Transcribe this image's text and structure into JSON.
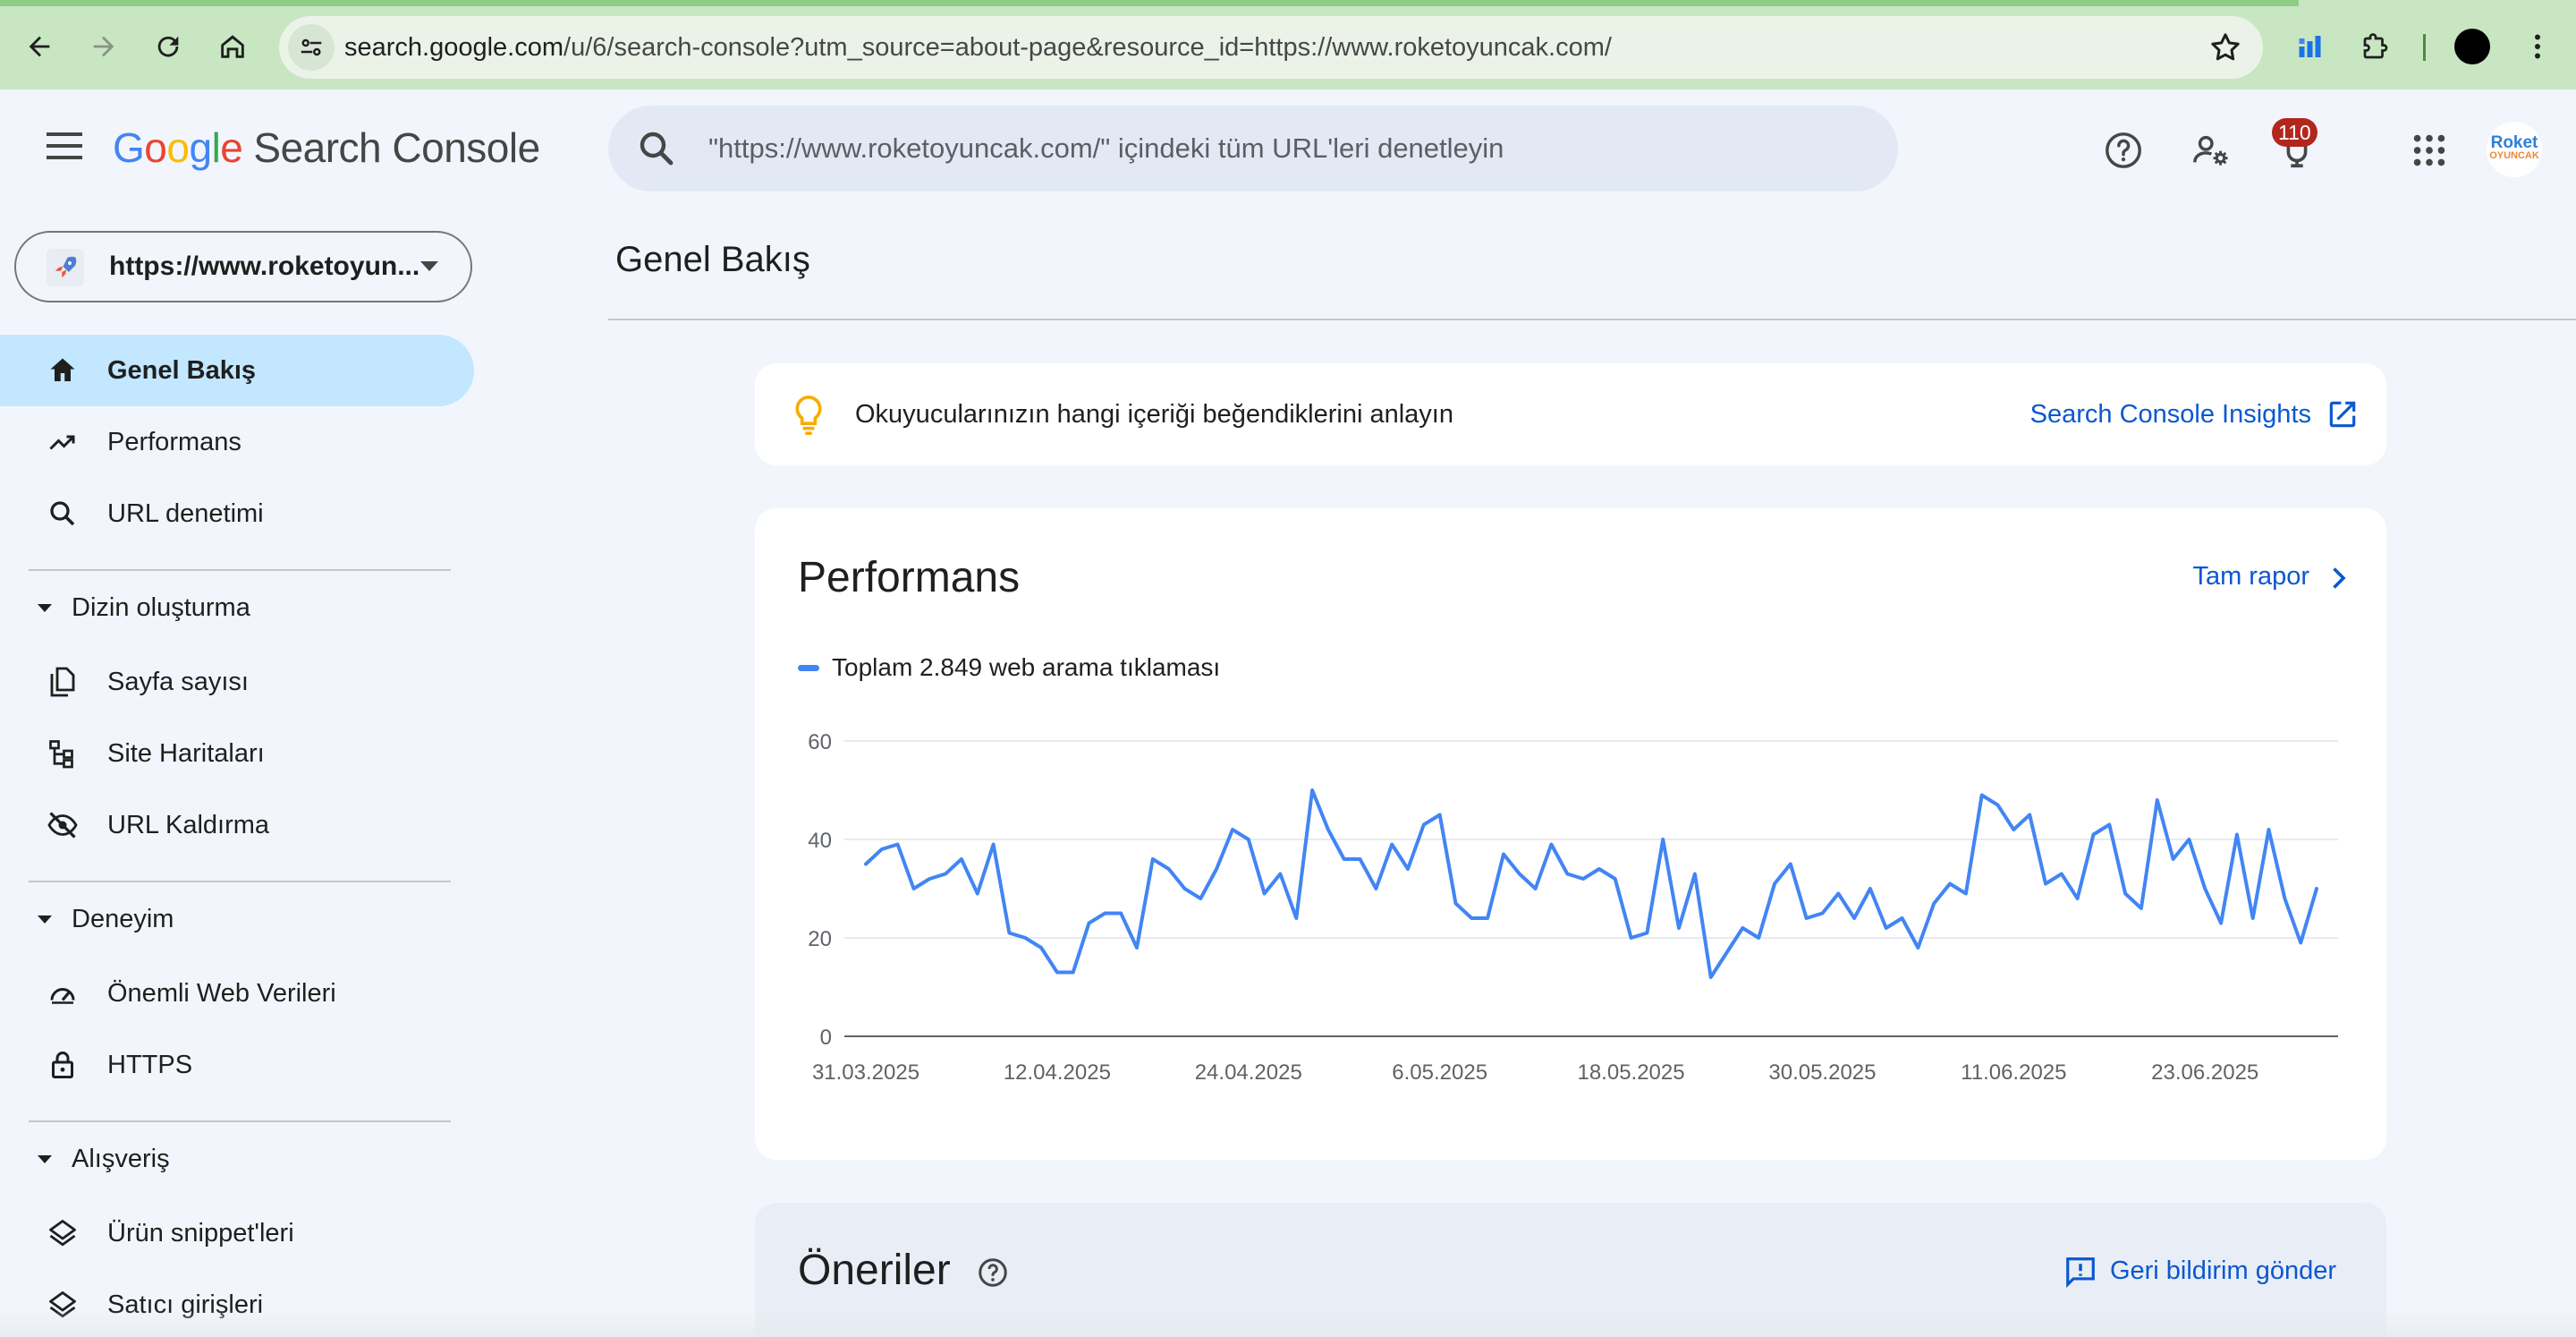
{
  "browser": {
    "url_host": "search.google.com",
    "url_path": "/u/6/search-console?utm_source=about-page&resource_id=https://www.roketoyuncak.com/",
    "icons": [
      "back-icon",
      "forward-icon",
      "reload-icon",
      "home-icon",
      "site-info-icon",
      "bookmark-star-icon",
      "extension-chart-icon",
      "extensions-puzzle-icon",
      "profile-icon",
      "more-vert-icon"
    ]
  },
  "header": {
    "logo_letters": [
      "G",
      "o",
      "o",
      "g",
      "l",
      "e"
    ],
    "product": "Search Console",
    "search_placeholder": "\"https://www.roketoyuncak.com/\" içindeki tüm URL'leri denetleyin",
    "notifications_count": "110",
    "avatar_line1": "Roket",
    "avatar_line2": "OYUNCAK"
  },
  "sidebar": {
    "property": "https://www.roketoyun...",
    "items": [
      {
        "label": "Genel Bakış",
        "icon": "home-icon",
        "active": true
      },
      {
        "label": "Performans",
        "icon": "trending-up-icon"
      },
      {
        "label": "URL denetimi",
        "icon": "search-icon"
      }
    ],
    "sections": [
      {
        "title": "Dizin oluşturma",
        "items": [
          {
            "label": "Sayfa sayısı",
            "icon": "pages-icon"
          },
          {
            "label": "Site Haritaları",
            "icon": "sitemap-icon"
          },
          {
            "label": "URL Kaldırma",
            "icon": "visibility-off-icon"
          }
        ]
      },
      {
        "title": "Deneyim",
        "items": [
          {
            "label": "Önemli Web Verileri",
            "icon": "speed-gauge-icon"
          },
          {
            "label": "HTTPS",
            "icon": "lock-icon"
          }
        ]
      },
      {
        "title": "Alışveriş",
        "items": [
          {
            "label": "Ürün snippet'leri",
            "icon": "layers-icon"
          },
          {
            "label": "Satıcı girişleri",
            "icon": "layers-icon"
          }
        ]
      }
    ]
  },
  "main": {
    "page_title": "Genel Bakış",
    "insight_text": "Okuyucularınızın hangi içeriği beğendiklerini anlayın",
    "insight_link": "Search Console Insights",
    "performance_title": "Performans",
    "performance_link": "Tam rapor",
    "recommendations_title": "Öneriler",
    "feedback_link": "Geri bildirim gönder"
  },
  "chart_data": {
    "type": "line",
    "legend": "Toplam 2.849 web arama tıklaması",
    "series_color": "#4285f4",
    "ylim": [
      0,
      60
    ],
    "yticks": [
      0,
      20,
      40,
      60
    ],
    "xticks": [
      "31.03.2025",
      "12.04.2025",
      "24.04.2025",
      "6.05.2025",
      "18.05.2025",
      "30.05.2025",
      "11.06.2025",
      "23.06.2025"
    ],
    "grid": true,
    "values": [
      35,
      38,
      39,
      30,
      32,
      33,
      36,
      29,
      39,
      21,
      20,
      18,
      13,
      13,
      23,
      25,
      25,
      18,
      36,
      34,
      30,
      28,
      34,
      42,
      40,
      29,
      33,
      24,
      50,
      42,
      36,
      36,
      30,
      39,
      34,
      43,
      45,
      27,
      24,
      24,
      37,
      33,
      30,
      39,
      33,
      32,
      34,
      32,
      20,
      21,
      40,
      22,
      33,
      12,
      17,
      22,
      20,
      31,
      35,
      24,
      25,
      29,
      24,
      30,
      22,
      24,
      18,
      27,
      31,
      29,
      49,
      47,
      42,
      45,
      31,
      33,
      28,
      41,
      43,
      29,
      26,
      48,
      36,
      40,
      30,
      23,
      41,
      24,
      42,
      28,
      19,
      30
    ]
  }
}
